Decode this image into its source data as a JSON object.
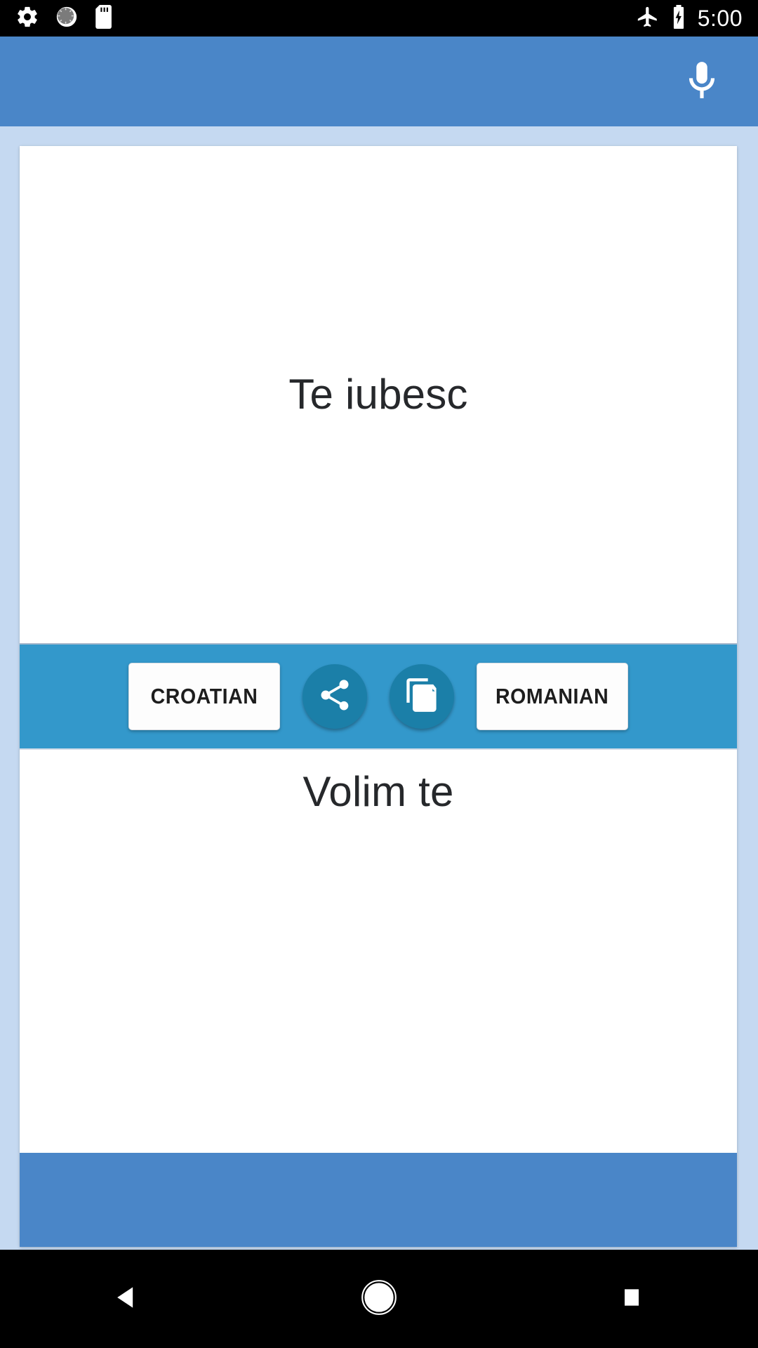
{
  "status_bar": {
    "left_icons": [
      {
        "name": "settings-gear-icon"
      },
      {
        "name": "dial-circle-icon"
      },
      {
        "name": "sd-card-icon"
      }
    ],
    "right_icons": [
      {
        "name": "airplane-mode-icon"
      },
      {
        "name": "battery-charging-icon"
      }
    ],
    "time": "5:00"
  },
  "app_bar": {
    "background_color": "#4a86c8",
    "mic_icon": "microphone-icon"
  },
  "translator": {
    "source_text": "Te iubesc",
    "target_text": "Volim te",
    "toolbar": {
      "background_color": "#3398cb",
      "source_language": "CROATIAN",
      "target_language": "ROMANIAN",
      "share_icon": "share-icon",
      "copy_icon": "copy-documents-icon",
      "circle_button_color": "#1b7fa8"
    }
  },
  "page": {
    "background_color": "#c5d9f1",
    "card_color": "#ffffff",
    "footer_color": "#4a86c8"
  },
  "nav_bar": {
    "back": "back-triangle-icon",
    "home": "home-circle-icon",
    "recents": "recents-square-icon"
  }
}
